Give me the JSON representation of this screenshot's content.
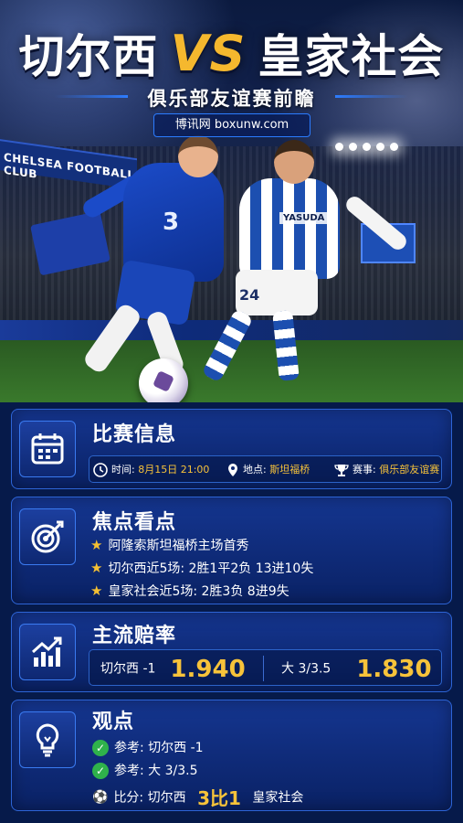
{
  "header": {
    "team_home": "切尔西",
    "vs": "VS",
    "team_away": "皇家社会",
    "subtitle": "俱乐部友谊赛前瞻",
    "website": "博讯网 boxunw.com"
  },
  "photo": {
    "stadium_banner": "CHELSEA FOOTBALL CLUB",
    "home_shirt_number": "3",
    "away_sponsor": "YASUDA",
    "away_shorts_number": "24"
  },
  "match_info": {
    "title": "比赛信息",
    "time_label": "时间:",
    "time_value": "8月15日 21:00",
    "venue_label": "地点:",
    "venue_value": "斯坦福桥",
    "event_label": "赛事:",
    "event_value": "俱乐部友谊赛"
  },
  "highlights": {
    "title": "焦点看点",
    "items": [
      "阿隆索斯坦福桥主场首秀",
      "切尔西近5场: 2胜1平2负 13进10失",
      "皇家社会近5场: 2胜3负 8进9失"
    ]
  },
  "odds": {
    "title": "主流赔率",
    "left_label": "切尔西 -1",
    "left_value": "1.940",
    "right_label": "大 3/3.5",
    "right_value": "1.830"
  },
  "opinion": {
    "title": "观点",
    "ref1": "参考: 切尔西 -1",
    "ref2": "参考: 大 3/3.5",
    "score_prefix": "比分: 切尔西",
    "score_value": "3比1",
    "score_suffix": "皇家社会"
  },
  "colors": {
    "accent_gold": "#f7c33a",
    "card_border": "#2d64d6",
    "background": "#061a4a"
  }
}
